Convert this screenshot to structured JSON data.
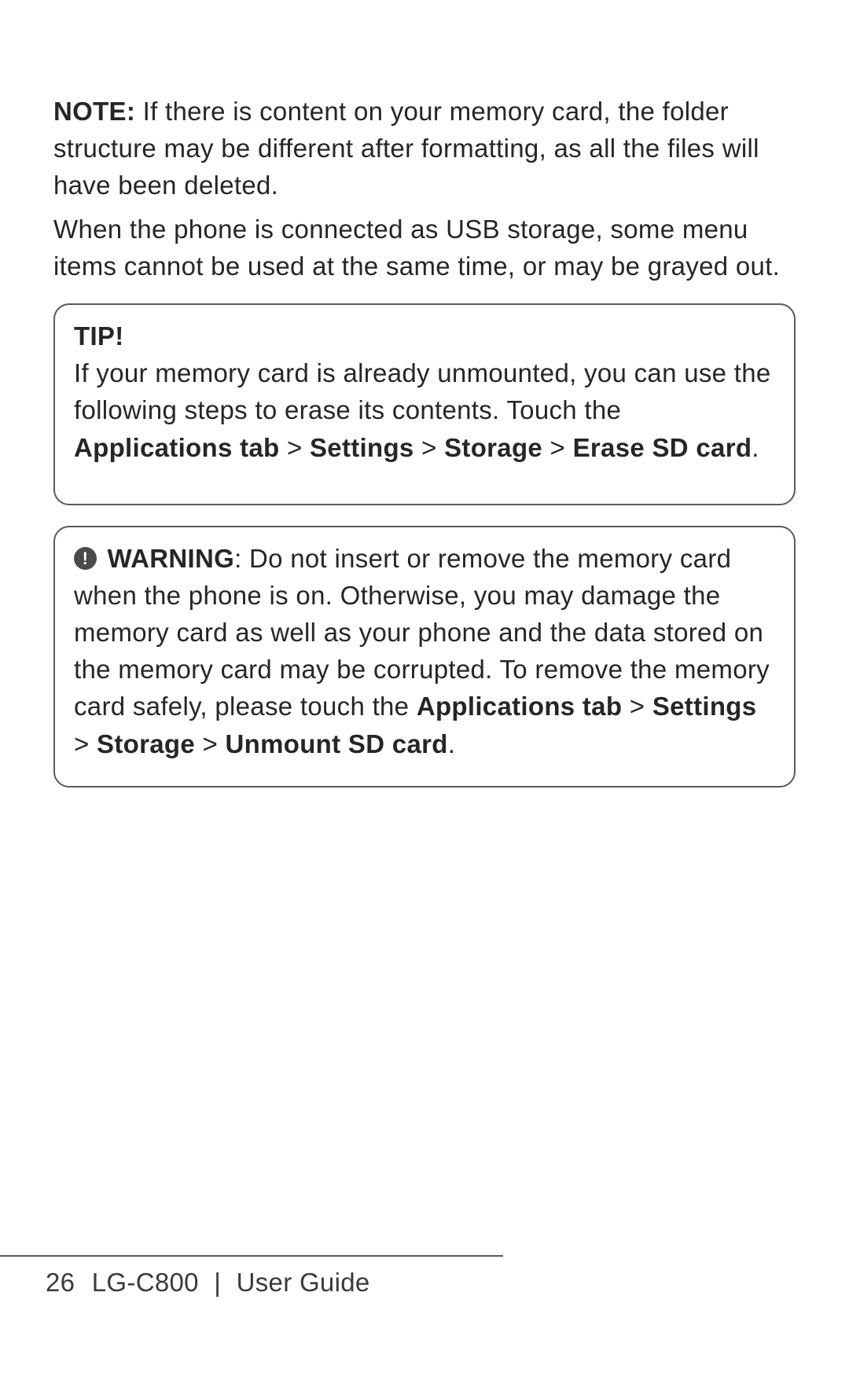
{
  "note": {
    "label": "NOTE:",
    "text": "If there is content on your memory card, the folder structure may be different after formatting, as all the files will have been deleted."
  },
  "body_text": "When the phone is connected as USB storage, some menu items cannot be used at the same time, or may be grayed out.",
  "tip": {
    "label": "TIP!",
    "text_before": "If your memory card is already unmounted, you can use the following steps to erase its contents. Touch the ",
    "nav_1": "Applications tab",
    "nav_2": "Settings",
    "nav_3": "Storage",
    "nav_4": "Erase SD card",
    "sep": " > ",
    "period": "."
  },
  "warning": {
    "icon": "!",
    "label": "WARNING",
    "text_before": ": Do not insert or remove the memory card when the phone is on. Otherwise, you may damage the memory card as well as your phone and the data stored on the memory card may be corrupted. To remove the memory card safely, please touch the ",
    "nav_1": "Applications tab",
    "nav_2": "Settings",
    "nav_3": "Storage",
    "nav_4": "Unmount SD card",
    "sep": " > ",
    "period": "."
  },
  "footer": {
    "page_number": "26",
    "model": "LG-C800",
    "separator": "|",
    "doc_title": "User Guide"
  }
}
